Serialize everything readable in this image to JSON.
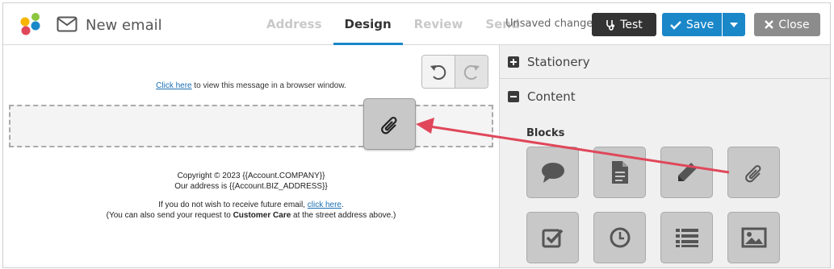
{
  "header": {
    "title": "New email",
    "tabs": [
      {
        "label": "Address",
        "active": false
      },
      {
        "label": "Design",
        "active": true
      },
      {
        "label": "Review",
        "active": false
      },
      {
        "label": "Send",
        "active": false
      }
    ],
    "unsaved_text": "Unsaved changes",
    "test_label": "Test",
    "save_label": "Save",
    "close_label": "Close"
  },
  "editor": {
    "view_link": "Click here",
    "view_rest": " to view this message in a browser window.",
    "copyright": "Copyright © 2023 {{Account.COMPANY}}",
    "address": "Our address is {{Account.BIZ_ADDRESS}}",
    "unsub_prefix": "If you do not wish to receive future email, ",
    "unsub_link": "click here",
    "unsub_suffix": ".",
    "contact_prefix": "(You can also send your request to ",
    "contact_bold": "Customer Care",
    "contact_suffix": " at the street address above.)"
  },
  "panel": {
    "stationery_label": "Stationery",
    "content_label": "Content",
    "blocks_label": "Blocks",
    "blocks": [
      {
        "icon": "speech-bubble-icon"
      },
      {
        "icon": "document-icon"
      },
      {
        "icon": "pencil-icon"
      },
      {
        "icon": "paperclip-icon"
      },
      {
        "icon": "checkbox-icon"
      },
      {
        "icon": "clock-icon"
      },
      {
        "icon": "list-icon"
      },
      {
        "icon": "image-icon"
      }
    ]
  },
  "colors": {
    "accent": "#1a87c9",
    "arrow": "#e0475a",
    "test_button": "#333333",
    "close_button": "#8c8c8c"
  }
}
